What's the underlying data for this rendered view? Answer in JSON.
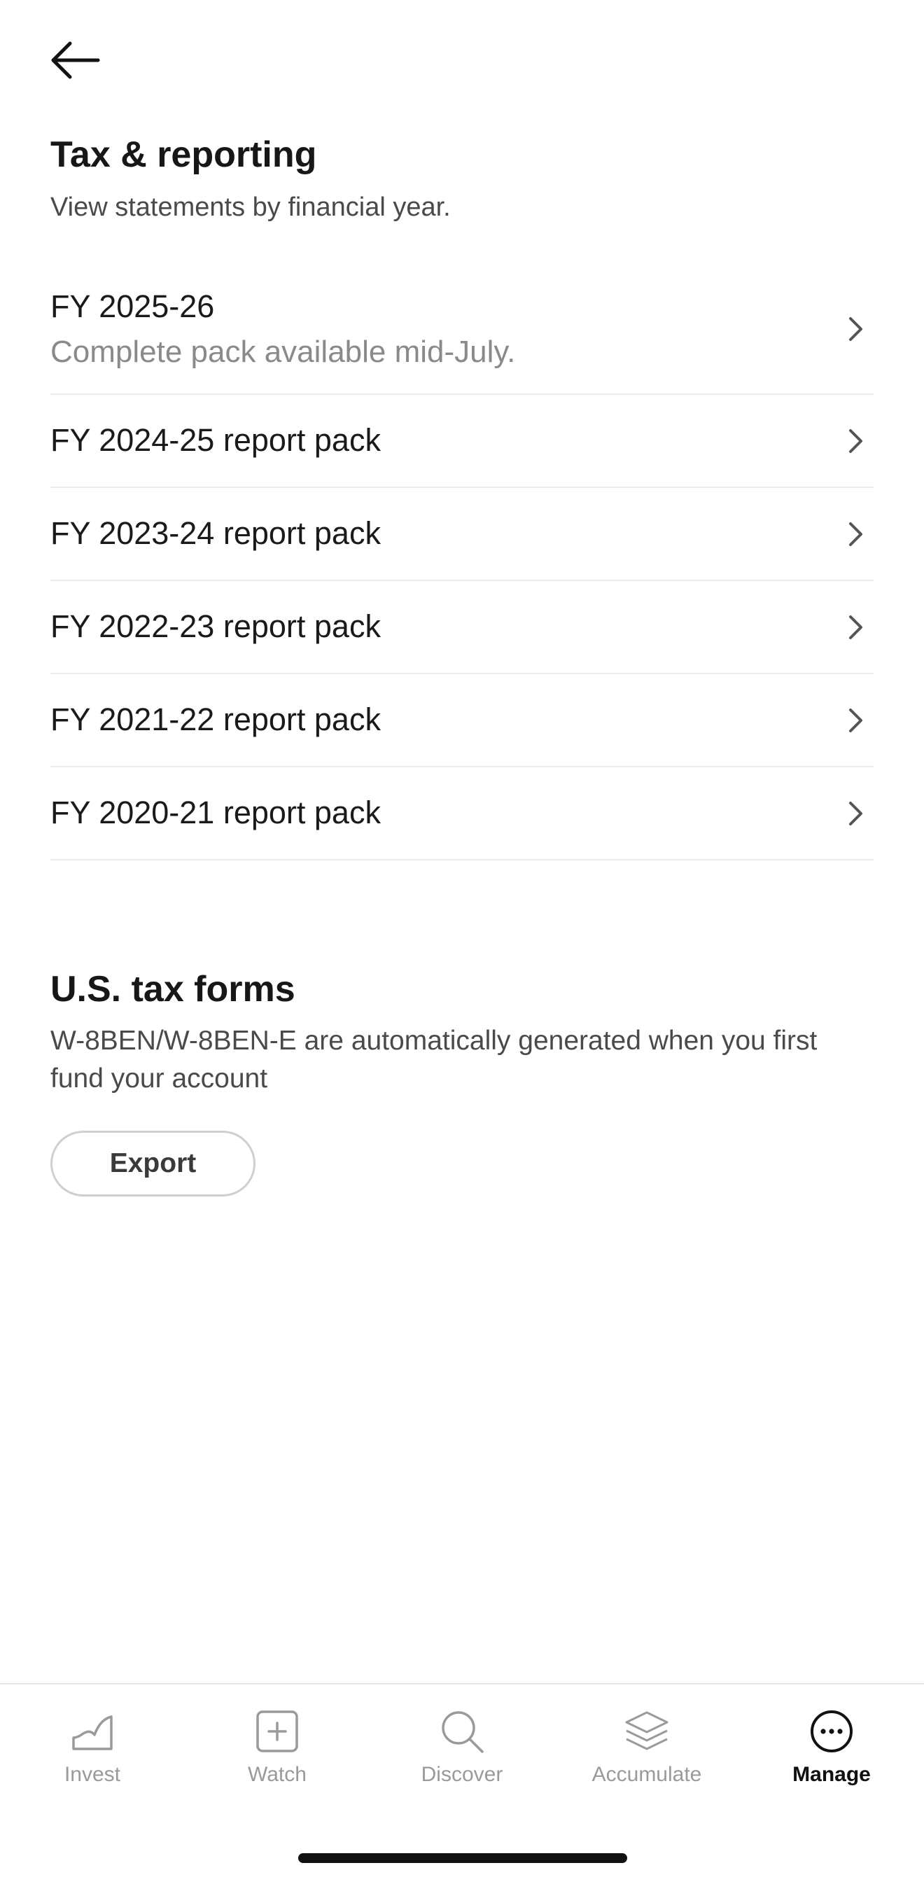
{
  "header": {
    "back_icon": "arrow-left-icon"
  },
  "tax_reporting": {
    "title": "Tax & reporting",
    "subtitle": "View statements by financial year.",
    "items": [
      {
        "label": "FY 2025-26",
        "sub": "Complete pack available mid-July."
      },
      {
        "label": "FY 2024-25 report pack"
      },
      {
        "label": "FY 2023-24 report pack"
      },
      {
        "label": "FY 2022-23 report pack"
      },
      {
        "label": "FY 2021-22 report pack"
      },
      {
        "label": "FY 2020-21 report pack"
      }
    ]
  },
  "us_tax": {
    "title": "U.S. tax forms",
    "description": "W-8BEN/W-8BEN-E are automatically generated when you first fund your account",
    "export_label": "Export"
  },
  "tabbar": {
    "tabs": [
      {
        "label": "Invest",
        "icon": "chart-icon"
      },
      {
        "label": "Watch",
        "icon": "plus-square-icon"
      },
      {
        "label": "Discover",
        "icon": "search-icon"
      },
      {
        "label": "Accumulate",
        "icon": "layers-icon"
      },
      {
        "label": "Manage",
        "icon": "more-circle-icon",
        "active": true
      }
    ]
  },
  "colors": {
    "text": "#1c1c1c",
    "muted": "#8a8a8a",
    "divider": "#ececec",
    "tab_inactive": "#9a9a9a"
  }
}
